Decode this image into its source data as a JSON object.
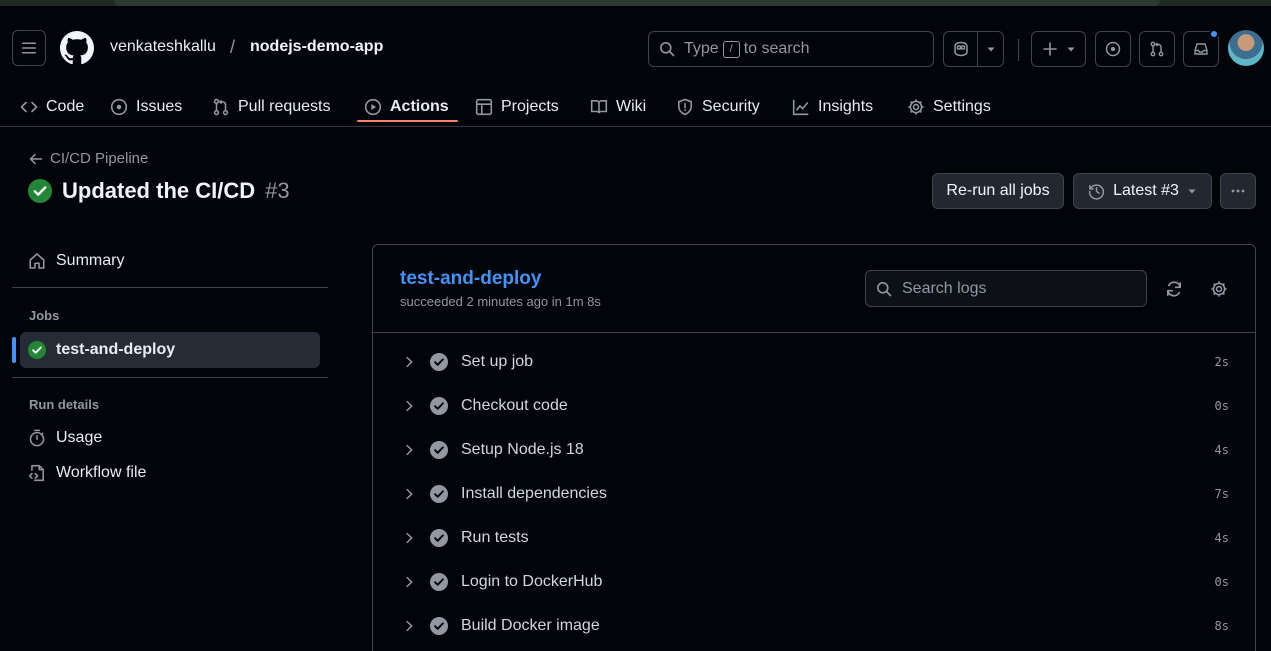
{
  "header": {
    "owner": "venkateshkallu",
    "separator": "/",
    "repo": "nodejs-demo-app",
    "search": {
      "prefix": "Type",
      "key": "/",
      "suffix": "to search"
    }
  },
  "tabs": [
    {
      "label": "Code",
      "icon": "code-icon"
    },
    {
      "label": "Issues",
      "icon": "issue-icon"
    },
    {
      "label": "Pull requests",
      "icon": "pull-request-icon"
    },
    {
      "label": "Actions",
      "icon": "play-icon",
      "active": true
    },
    {
      "label": "Projects",
      "icon": "table-icon"
    },
    {
      "label": "Wiki",
      "icon": "book-icon"
    },
    {
      "label": "Security",
      "icon": "shield-icon"
    },
    {
      "label": "Insights",
      "icon": "graph-icon"
    },
    {
      "label": "Settings",
      "icon": "gear-icon"
    }
  ],
  "run": {
    "back_label": "CI/CD Pipeline",
    "title": "Updated the CI/CD",
    "number": "#3",
    "status": "success",
    "rerun_label": "Re-run all jobs",
    "attempt_label": "Latest #3"
  },
  "sidebar": {
    "summary_label": "Summary",
    "jobs_heading": "Jobs",
    "job_label": "test-and-deploy",
    "run_details_heading": "Run details",
    "usage_label": "Usage",
    "workflow_label": "Workflow file"
  },
  "job": {
    "name": "test-and-deploy",
    "subtitle": "succeeded 2 minutes ago in 1m 8s",
    "search_placeholder": "Search logs",
    "steps": [
      {
        "name": "Set up job",
        "duration": "2s"
      },
      {
        "name": "Checkout code",
        "duration": "0s"
      },
      {
        "name": "Setup Node.js 18",
        "duration": "4s"
      },
      {
        "name": "Install dependencies",
        "duration": "7s"
      },
      {
        "name": "Run tests",
        "duration": "4s"
      },
      {
        "name": "Login to DockerHub",
        "duration": "0s"
      },
      {
        "name": "Build Docker image",
        "duration": "8s"
      }
    ]
  },
  "colors": {
    "success": "#238636",
    "link": "#4493f8",
    "active_tab_underline": "#f78166",
    "step_check": "#9198a1"
  }
}
